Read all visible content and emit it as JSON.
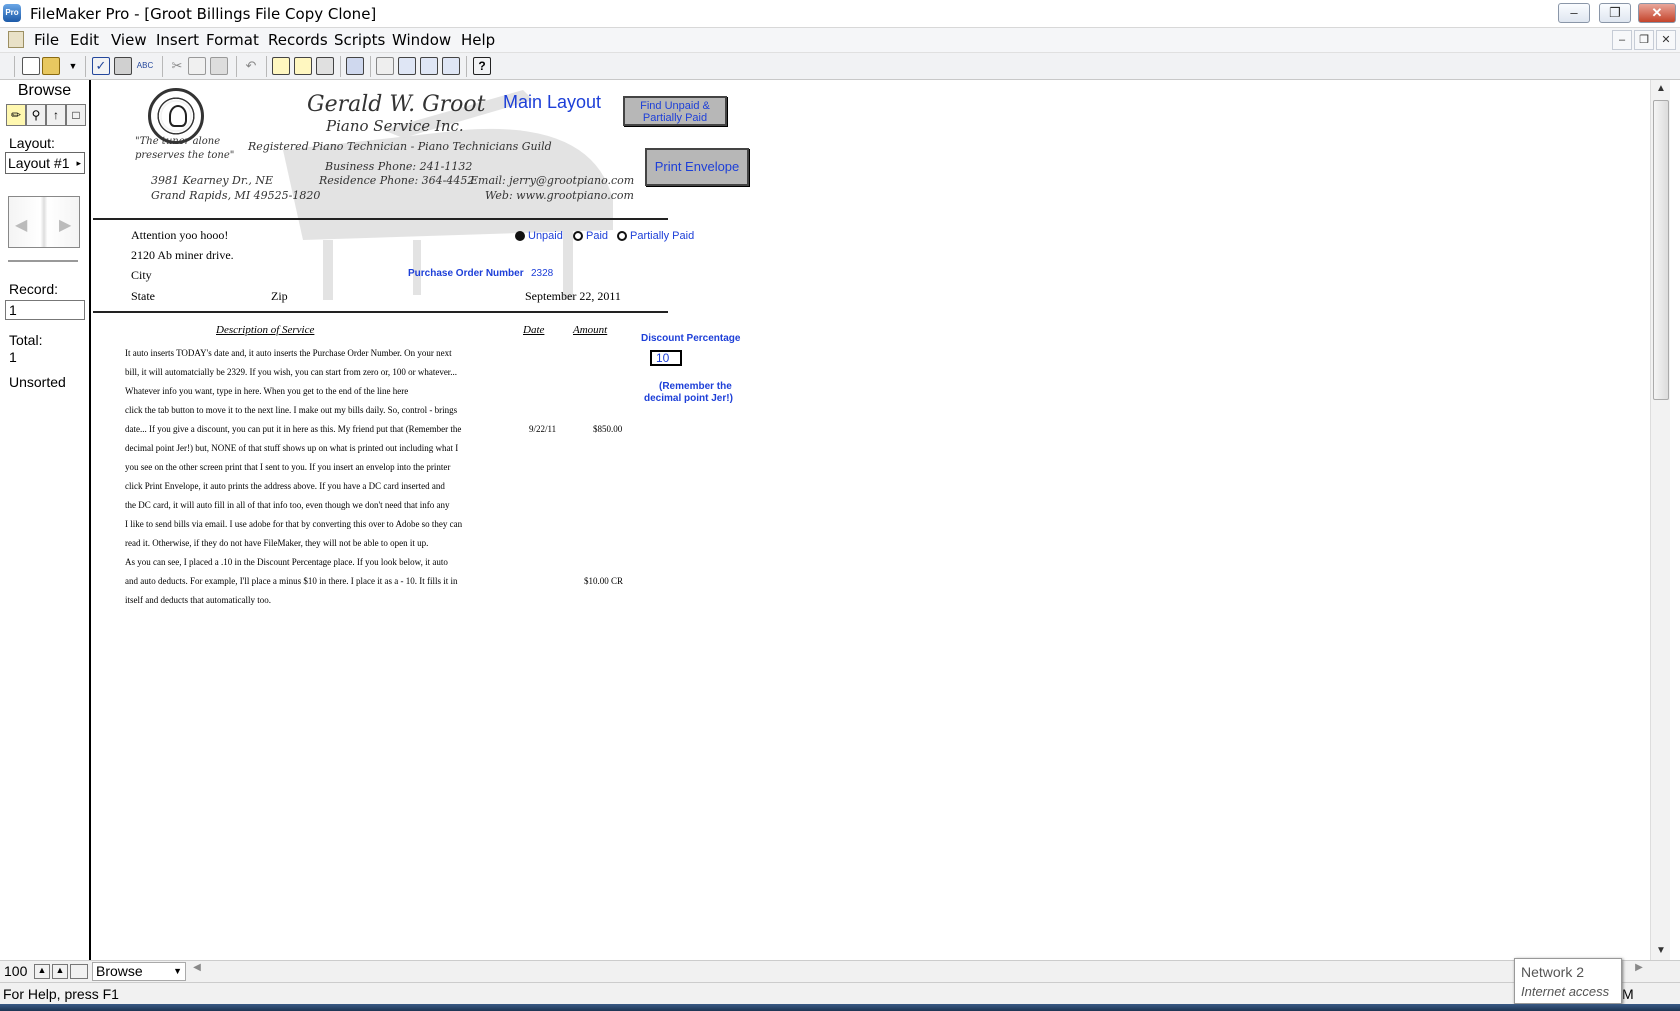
{
  "window": {
    "title": "FileMaker Pro - [Groot Billings File  Copy Clone]",
    "app_icon": "Pro",
    "controls": [
      "minimize-icon",
      "restore-icon",
      "close-icon"
    ]
  },
  "menubar": {
    "items": [
      "File",
      "Edit",
      "View",
      "Insert",
      "Format",
      "Records",
      "Scripts",
      "Window",
      "Help"
    ]
  },
  "toolbar": {
    "icons": [
      "new-icon",
      "open-icon",
      "dropdown-icon",
      "check-icon",
      "print-icon",
      "spellcheck-icon",
      "cut-icon",
      "copy-icon",
      "paste-icon",
      "undo-icon",
      "new-record-icon",
      "duplicate-record-icon",
      "delete-record-icon",
      "find-icon",
      "sort-icon",
      "omit-icon",
      "show-all-icon",
      "replace-icon",
      "help-icon"
    ]
  },
  "status_area": {
    "mode": "Browse",
    "layout_label": "Layout:",
    "layout_value": "Layout #1",
    "record_label": "Record:",
    "record_value": "1",
    "total_label": "Total:",
    "total_value": "1",
    "sort_state": "Unsorted"
  },
  "layout": {
    "company": {
      "name": "Gerald W. Groot",
      "subtitle": "Piano Service Inc.",
      "tagline": "Registered Piano Technician - Piano Technicians Guild",
      "motto": [
        "\"The tuner alone",
        "preserves the tone\""
      ],
      "address": [
        "3981 Kearney Dr., NE",
        "Grand Rapids, MI  49525-1820"
      ],
      "business_phone": "Business Phone:  241-1132",
      "residence_phone": "Residence Phone:  364-4452",
      "email": "Email:  jerry@grootpiano.com",
      "web": "Web:  www.grootpiano.com"
    },
    "heading": "Main Layout",
    "find_button": "Find Unpaid & Partially Paid",
    "print_button": "Print Envelope",
    "customer": {
      "name": "Attention yoo hooo!",
      "street": "2120 Ab miner drive.",
      "city": "City",
      "state": "State",
      "zip": "Zip"
    },
    "payment_status": {
      "options": [
        "Unpaid",
        "Paid",
        "Partially Paid"
      ],
      "selected": "Unpaid"
    },
    "po_label": "Purchase Order Number",
    "po_number": "2328",
    "date": "September 22, 2011",
    "columns": {
      "description": "Description of Service",
      "date": "Date",
      "amount": "Amount"
    },
    "description_lines": [
      "It auto inserts TODAY's date and, it auto inserts the Purchase Order Number.  On your next",
      "bill, it will automatcially be 2329.  If you wish, you can start from zero or, 100 or whatever...",
      "Whatever info you want, type in here.  When you get to the end of the line here",
      "click the tab button to move it to the next line.  I make out my bills daily.  So, control - brings",
      "date... If you give a discount, you can put it in here as this.   My friend put that (Remember the",
      "decimal point Jer!) but, NONE of that stuff shows up on what is printed out including what I",
      "you see on the other screen print that I sent to you.  If you insert an envelop into the printer",
      "click Print Envelope, it auto prints the address above.  If you have a DC card inserted and",
      "the DC card, it will auto fill in all of that info too, even though we don't need that info any",
      "I like to send bills via email. I use adobe for that by converting this over to Adobe so they can",
      "read it.  Otherwise, if they do not have FileMaker, they will not be able to open it up.",
      "As you can see, I placed a .10 in the Discount Percentage place.  If you look below, it auto",
      "and auto deducts.  For example, I'll place a minus $10 in there.  I place it as a - 10.  It fills it in",
      "itself and deducts that automatically too."
    ],
    "line_items": [
      {
        "date": "9/22/11",
        "amount": "$850.00"
      },
      {
        "date": "",
        "amount": "$10.00 CR"
      }
    ],
    "discount_label": "Discount Percentage",
    "discount_value": "10",
    "discount_note": [
      "(Remember the",
      "decimal point Jer!)"
    ]
  },
  "bottom": {
    "zoom": "100",
    "mode_select": "Browse",
    "help_text": "For Help, press F1",
    "network_title": "Network  2",
    "network_status": "Internet access",
    "trailing_char": "M"
  }
}
